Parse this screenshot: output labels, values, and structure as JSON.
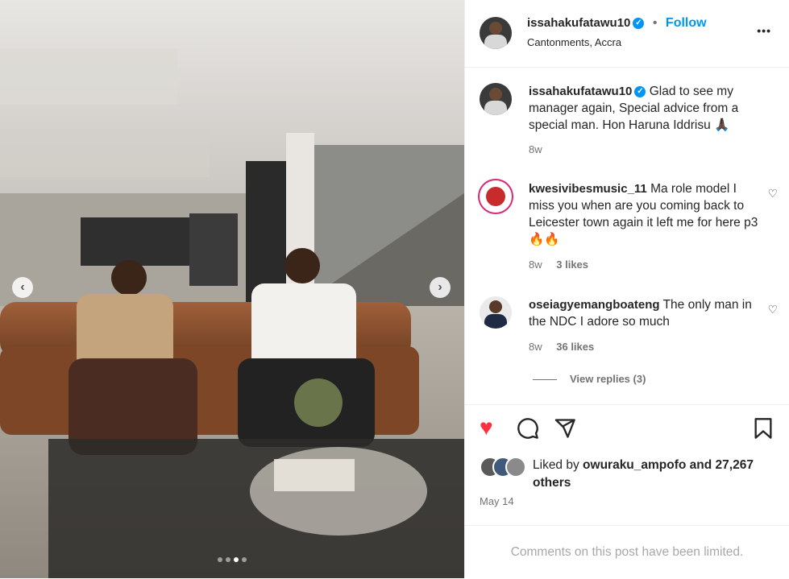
{
  "post": {
    "author": "issahakufatawu10",
    "location": "Cantonments, Accra",
    "follow_label": "Follow",
    "more_label": "•••",
    "follow_sep": "•",
    "carousel": {
      "prev": "‹",
      "next": "›",
      "slides": 4,
      "active": 2
    }
  },
  "comments": [
    {
      "user": "issahakufatawu10",
      "verified": true,
      "text": "Glad to see my manager again, Special advice from a special man. Hon Haruna Iddrisu 🙏🏿",
      "age": "8w",
      "likes": ""
    },
    {
      "user": "kwesivibesmusic_11",
      "verified": false,
      "text": "Ma role model I miss you when are you coming back to Leicester town again it left me for here p3🔥🔥",
      "age": "8w",
      "likes": "3 likes"
    },
    {
      "user": "oseiagyemangboateng",
      "verified": false,
      "text": "The only man in the NDC I adore so much",
      "age": "8w",
      "likes": "36 likes"
    }
  ],
  "view_replies": "View replies (3)",
  "likes": {
    "prefix": "Liked by ",
    "user": "owuraku_ampofo",
    "suffix": " and 27,267 others"
  },
  "date": "May 14",
  "limited": "Comments on this post have been limited.",
  "colors": {
    "like_red": "#ff3040",
    "link_blue": "#0095f6",
    "verified": "#0095f6"
  }
}
